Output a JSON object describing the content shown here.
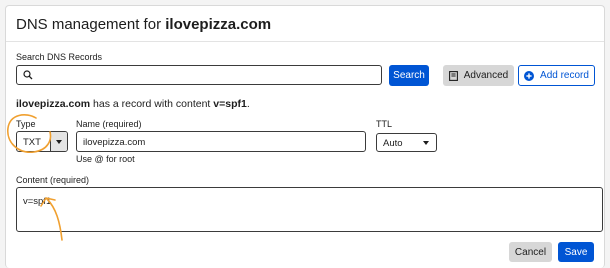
{
  "page": {
    "title_prefix": "DNS management for ",
    "title_domain": "ilovepizza.com"
  },
  "search": {
    "label": "Search DNS Records",
    "value": "",
    "placeholder": "",
    "button_label": "Search"
  },
  "toolbar": {
    "advanced_label": "Advanced",
    "add_record_label": "Add record"
  },
  "info": {
    "domain": "ilovepizza.com",
    "middle_text": " has a record with content ",
    "content_value": "v=spf1",
    "end": "."
  },
  "form": {
    "type_label": "Type",
    "type_value": "TXT",
    "name_label": "Name (required)",
    "name_value": "ilovepizza.com",
    "name_hint": "Use @ for root",
    "ttl_label": "TTL",
    "ttl_value": "Auto",
    "content_label": "Content (required)",
    "content_value": "v=spf1"
  },
  "actions": {
    "cancel_label": "Cancel",
    "save_label": "Save"
  },
  "colors": {
    "primary": "#0055d4",
    "annotation": "#f0a030"
  },
  "icons": [
    "search-icon",
    "advanced-icon",
    "plus-circle-icon",
    "chevron-down-icon"
  ]
}
